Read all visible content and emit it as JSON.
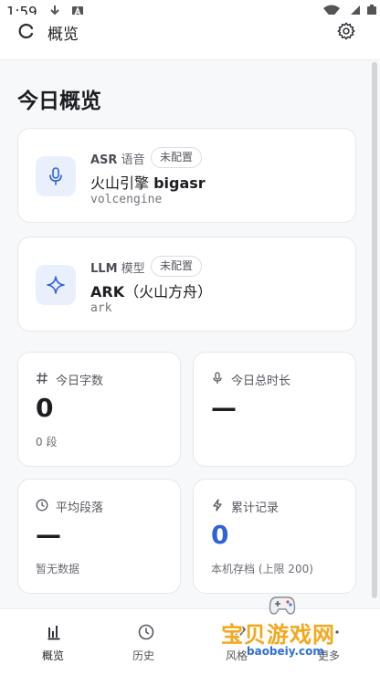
{
  "status_bar": {
    "time": "1:59"
  },
  "app_bar": {
    "title": "概览"
  },
  "page": {
    "title": "今日概览"
  },
  "engines": [
    {
      "kind_code": "ASR",
      "kind_label": "语音",
      "badge": "未配置",
      "name_prefix": "火山引擎 ",
      "name_bold": "bigasr",
      "id": "volcengine",
      "icon": "microphone-icon"
    },
    {
      "kind_code": "LLM",
      "kind_label": "模型",
      "badge": "未配置",
      "name_prefix": "",
      "name_bold": "ARK",
      "name_suffix": "（火山方舟）",
      "id": "ark",
      "icon": "sparkle-icon"
    }
  ],
  "stats": {
    "chars_today": {
      "label": "今日字数",
      "value": "0",
      "sub": "0 段",
      "icon": "hash-icon"
    },
    "duration_today": {
      "label": "今日总时长",
      "value": "—",
      "icon": "microphone-icon"
    },
    "avg_paragraph": {
      "label": "平均段落",
      "value": "—",
      "sub": "暂无数据",
      "icon": "clock-icon"
    },
    "total_records": {
      "label": "累计记录",
      "value": "0",
      "sub": "本机存档 (上限 200)",
      "icon": "bolt-icon"
    }
  },
  "nav": [
    {
      "label": "概览",
      "icon": "bar-chart-icon"
    },
    {
      "label": "历史",
      "icon": "clock-icon"
    },
    {
      "label": "风格",
      "icon": "style-icon"
    },
    {
      "label": "更多",
      "icon": "more-icon"
    }
  ],
  "watermark": {
    "text": "宝贝游戏网",
    "domain": "baobeiy.com"
  },
  "colors": {
    "accent": "#2e62d9",
    "icon_bg": "#e9effb",
    "watermark": "#f2a81d"
  }
}
